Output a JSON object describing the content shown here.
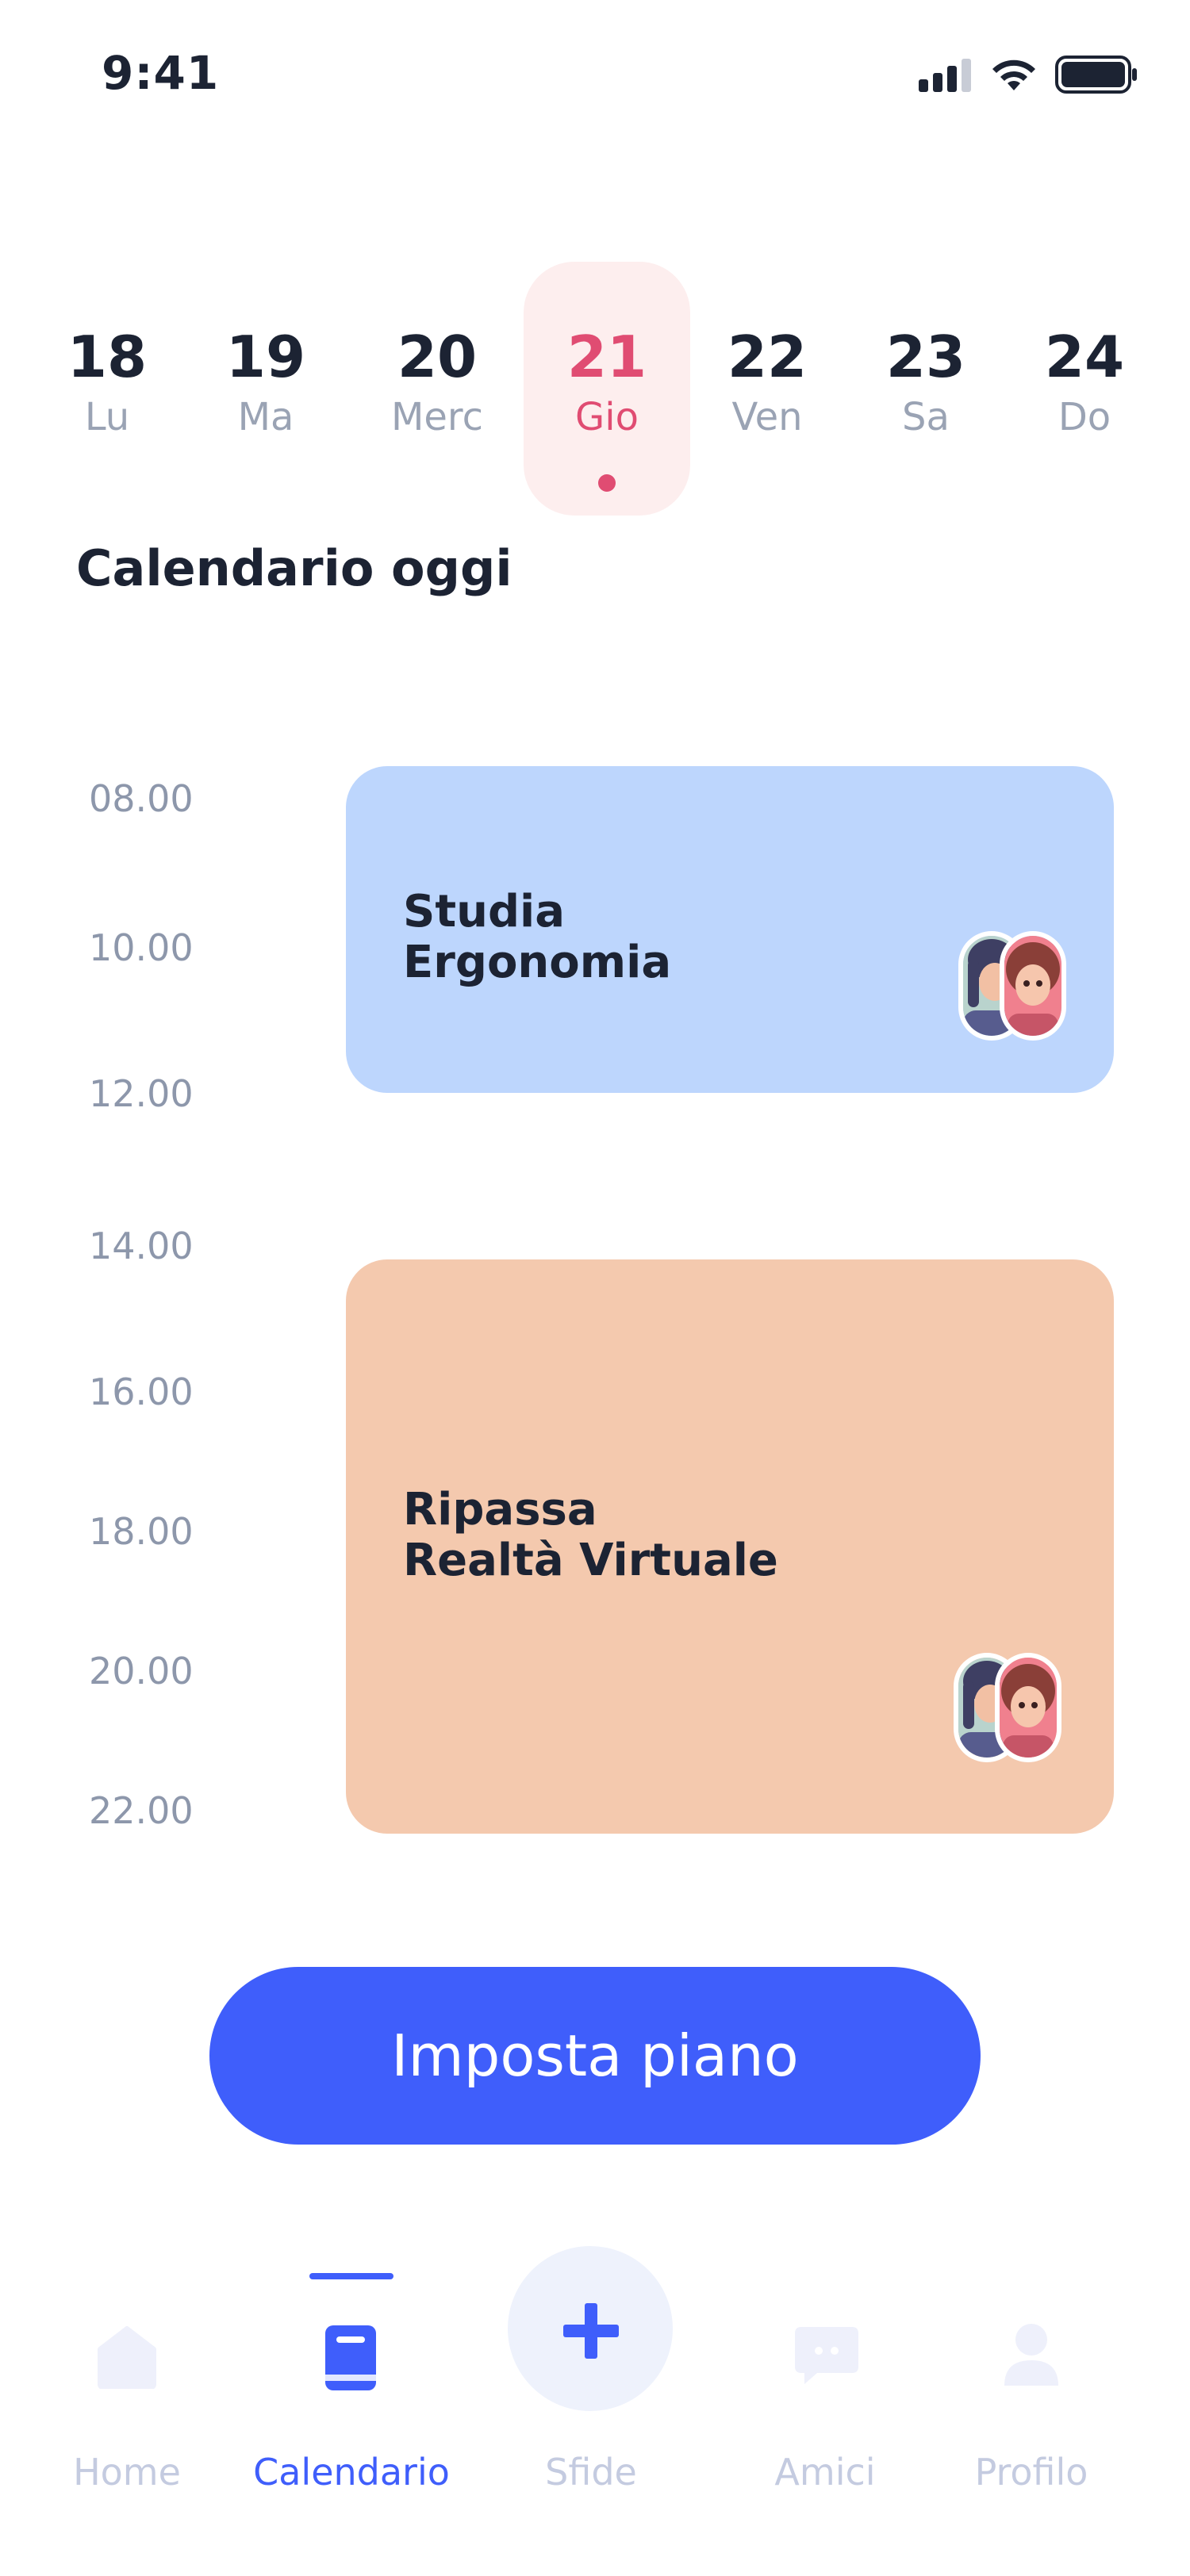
{
  "status_bar": {
    "time": "9:41"
  },
  "week": {
    "days": [
      {
        "num": "18",
        "name": "Lu"
      },
      {
        "num": "19",
        "name": "Ma"
      },
      {
        "num": "20",
        "name": "Merc"
      },
      {
        "num": "21",
        "name": "Gio",
        "selected": true
      },
      {
        "num": "22",
        "name": "Ven"
      },
      {
        "num": "23",
        "name": "Sa"
      },
      {
        "num": "24",
        "name": "Do"
      }
    ]
  },
  "section_title": "Calendario oggi",
  "hours": [
    "08.00",
    "10.00",
    "12.00",
    "14.00",
    "16.00",
    "18.00",
    "20.00",
    "22.00"
  ],
  "events": [
    {
      "title_line1": "Studia",
      "title_line2": "Ergonomia",
      "color": "#bdd6fd"
    },
    {
      "title_line1": "Ripassa",
      "title_line2": "Realtà Virtuale",
      "color": "#f4c9ae"
    }
  ],
  "cta": {
    "label": "Imposta piano"
  },
  "nav": {
    "items": [
      {
        "label": "Home",
        "icon": "home-icon"
      },
      {
        "label": "Calendario",
        "icon": "book-icon",
        "active": true
      },
      {
        "label": "Sfide",
        "icon": "plus-icon"
      },
      {
        "label": "Amici",
        "icon": "chat-icon"
      },
      {
        "label": "Profilo",
        "icon": "user-icon"
      }
    ]
  },
  "colors": {
    "accent": "#3f5efb",
    "selected_day": "#e04c72",
    "selected_day_bg": "#fdeeee"
  }
}
